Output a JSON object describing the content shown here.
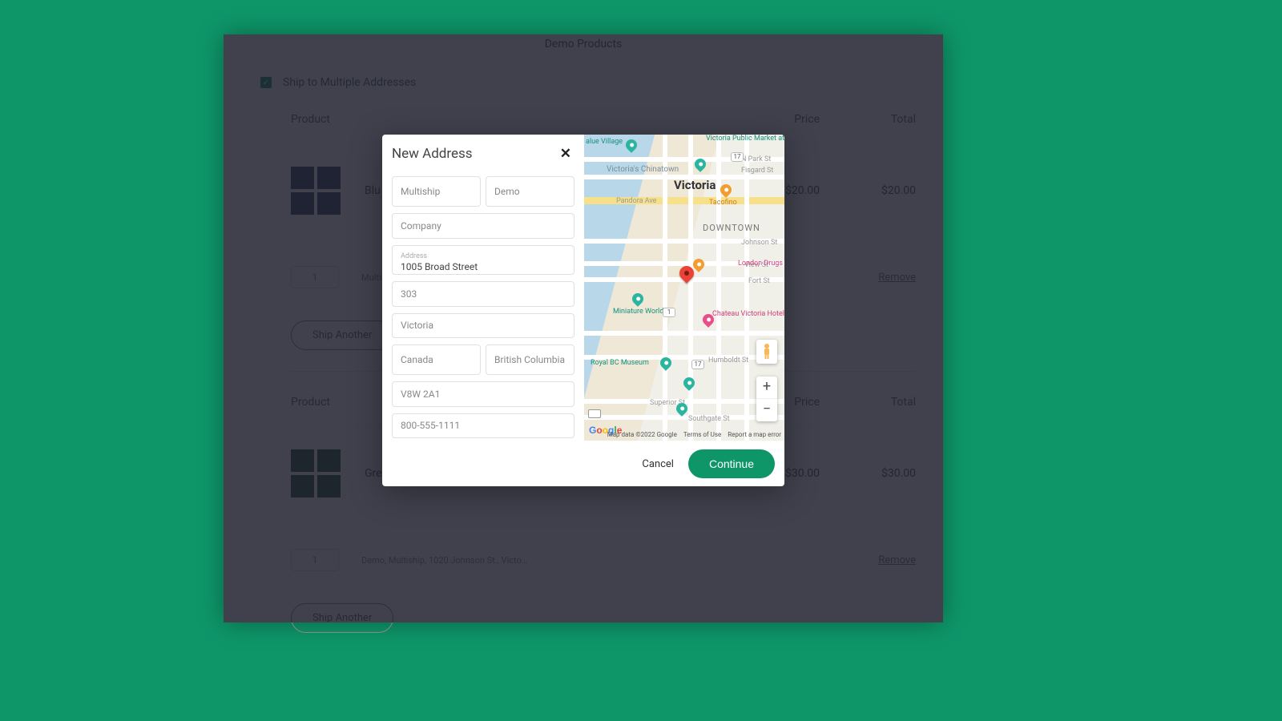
{
  "page_title": "Demo Products",
  "multiship": {
    "checked": true,
    "label": "Ship to Multiple Addresses"
  },
  "columns": {
    "product": "Product",
    "price": "Price",
    "total": "Total"
  },
  "items": [
    {
      "name": "Blu",
      "price": "$20.00",
      "total": "$20.00",
      "qty": "1",
      "address_selected": "Multiship Demo",
      "swatch": "blue"
    },
    {
      "name": "Gre",
      "price": "$30.00",
      "total": "$30.00",
      "qty": "1",
      "address_selected": "Demo, Multiship, 1020 Johnson St., Victo…",
      "swatch": "green"
    }
  ],
  "remove_label": "Remove",
  "ship_another_label": "Ship Another",
  "modal": {
    "title": "New Address",
    "fields": {
      "first_name": "Multiship",
      "last_name": "Demo",
      "company_placeholder": "Company",
      "address_label": "Address",
      "address": "1005 Broad Street",
      "address2": "303",
      "city": "Victoria",
      "country": "Canada",
      "province": "British Columbia",
      "postal": "V8W 2A1",
      "phone": "800-555-1111"
    },
    "cancel": "Cancel",
    "continue": "Continue"
  },
  "map": {
    "city_label": "Victoria",
    "downtown_label": "DOWNTOWN",
    "chinatown_label": "Victoria's Chinatown",
    "streets": {
      "pandora": "Pandora Ave",
      "npark": "N Park St",
      "fisgard": "Fisgard St",
      "johnson": "Johnson St",
      "view": "View St",
      "fort": "Fort St",
      "humboldt": "Humboldt St",
      "superior": "Superior St",
      "southgate": "Southgate St"
    },
    "pois": {
      "value_village": "alue Village",
      "public_market": "Victoria Public Market at the Hudson",
      "tacofino": "Tacofino",
      "miniature": "Miniature World",
      "chateau": "Chateau Victoria Hotel & Suites",
      "royal_bc": "Royal BC Museum",
      "london_drugs": "London Drugs"
    },
    "shields": {
      "s1": "1",
      "s17a": "17",
      "s17b": "17"
    },
    "attribution": {
      "data": "Map data ©2022 Google",
      "terms": "Terms of Use",
      "report": "Report a map error"
    }
  }
}
